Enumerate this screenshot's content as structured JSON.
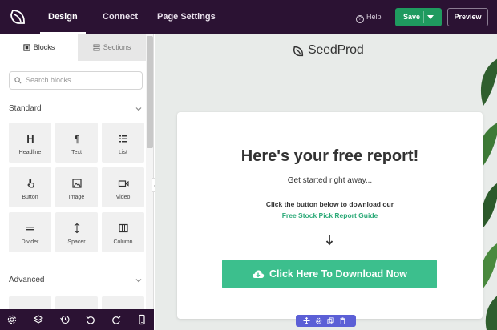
{
  "topbar": {
    "tabs": [
      "Design",
      "Connect",
      "Page Settings"
    ],
    "help": "Help",
    "save": "Save",
    "preview": "Preview"
  },
  "sidebar": {
    "tabs": [
      "Blocks",
      "Sections"
    ],
    "search_placeholder": "Search blocks...",
    "standard_label": "Standard",
    "advanced_label": "Advanced",
    "blocks": [
      {
        "label": "Headline",
        "icon": "headline-icon"
      },
      {
        "label": "Text",
        "icon": "paragraph-icon"
      },
      {
        "label": "List",
        "icon": "list-icon"
      },
      {
        "label": "Button",
        "icon": "pointer-icon"
      },
      {
        "label": "Image",
        "icon": "image-icon"
      },
      {
        "label": "Video",
        "icon": "video-icon"
      },
      {
        "label": "Divider",
        "icon": "divider-icon"
      },
      {
        "label": "Spacer",
        "icon": "spacer-icon"
      },
      {
        "label": "Column",
        "icon": "columns-icon"
      }
    ]
  },
  "bottombar": {
    "icons": [
      "settings-icon",
      "layers-icon",
      "history-icon",
      "undo-icon",
      "redo-icon",
      "mobile-icon"
    ]
  },
  "canvas": {
    "brand": "SeedProd",
    "headline": "Here's your free report!",
    "subheadline": "Get started right away...",
    "body_line1": "Click the button below to download our",
    "body_line2": "Free Stock Pick Report Guide",
    "cta": "Click Here To Download Now"
  },
  "colors": {
    "topbar": "#2b1233",
    "save": "#1f9a5f",
    "cta": "#3cbf8d",
    "link": "#2fab7a",
    "toolbar": "#5b5fd6"
  }
}
